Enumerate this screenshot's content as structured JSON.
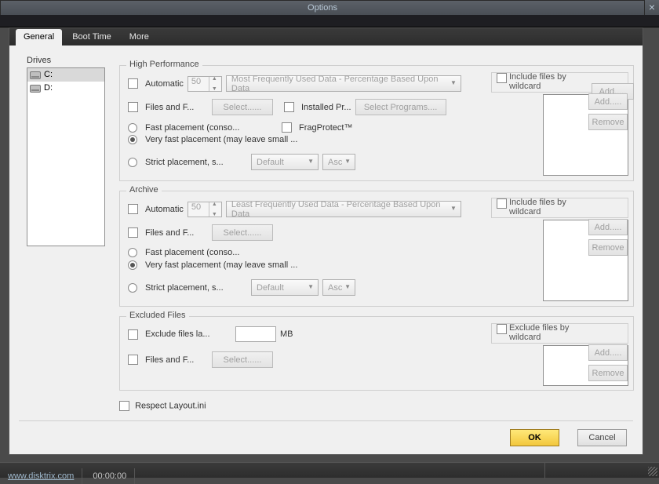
{
  "window": {
    "title": "Options"
  },
  "tabs": {
    "general": "General",
    "boot": "Boot Time",
    "more": "More"
  },
  "drives": {
    "label": "Drives",
    "items": [
      "C:",
      "D:"
    ],
    "selected": 0
  },
  "hp": {
    "legend": "High Performance",
    "automatic": "Automatic",
    "auto_value": "50",
    "auto_combo": "Most Frequently Used Data - Percentage Based Upon Data",
    "files_and_f": "Files and F...",
    "select_btn": "Select......",
    "installed_pr": "Installed Pr...",
    "select_programs_btn": "Select Programs....",
    "radio_fast": "Fast placement (conso...",
    "fragprotect": "FragProtect™",
    "radio_veryfast": "Very fast placement (may leave small ...",
    "radio_strict": "Strict placement, s...",
    "strict_combo": "Default",
    "order_combo": "Asc",
    "include_wc": "Include files by\nwildcard",
    "add_btn": "Add.....",
    "remove_btn": "Remove"
  },
  "ar": {
    "legend": "Archive",
    "automatic": "Automatic",
    "auto_value": "50",
    "auto_combo": "Least Frequently Used Data - Percentage Based Upon Data",
    "files_and_f": "Files and F...",
    "select_btn": "Select......",
    "radio_fast": "Fast placement (conso...",
    "radio_veryfast": "Very fast placement (may leave small ...",
    "radio_strict": "Strict placement, s...",
    "strict_combo": "Default",
    "order_combo": "Asc",
    "include_wc": "Include files by\nwildcard",
    "add_btn": "Add.....",
    "remove_btn": "Remove"
  },
  "ex": {
    "legend": "Excluded Files",
    "exclude_larger": "Exclude files la...",
    "mb_label": "MB",
    "files_and_f": "Files and F...",
    "select_btn": "Select......",
    "exclude_wc": "Exclude files by\nwildcard",
    "add_btn": "Add.....",
    "remove_btn": "Remove"
  },
  "respect": "Respect Layout.ini",
  "buttons": {
    "ok": "OK",
    "cancel": "Cancel"
  },
  "status": {
    "url": "www.disktrix.com",
    "time": "00:00:00"
  }
}
